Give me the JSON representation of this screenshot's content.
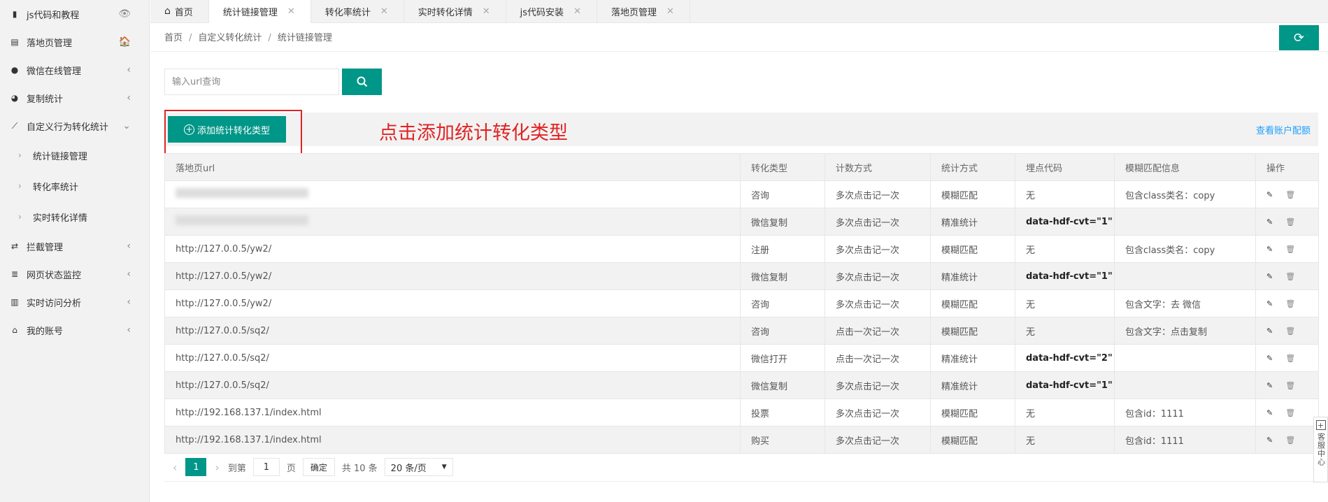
{
  "sidebar": {
    "items": [
      {
        "label": "js代码和教程",
        "icon": "bookmark-icon",
        "right": "👁"
      },
      {
        "label": "落地页管理",
        "icon": "document-icon",
        "right": "🏠"
      },
      {
        "label": "微信在线管理",
        "icon": "wechat-icon",
        "right": "‹"
      },
      {
        "label": "复制统计",
        "icon": "pie-chart-icon",
        "right": "‹"
      },
      {
        "label": "自定义行为转化统计",
        "icon": "line-chart-icon",
        "right": "⌄"
      },
      {
        "label": "统计链接管理",
        "child": true
      },
      {
        "label": "转化率统计",
        "child": true
      },
      {
        "label": "实时转化详情",
        "child": true
      },
      {
        "label": "拦截管理",
        "icon": "exchange-icon",
        "right": "‹"
      },
      {
        "label": "网页状态监控",
        "icon": "server-icon",
        "right": "‹"
      },
      {
        "label": "实时访问分析",
        "icon": "bar-chart-icon",
        "right": "‹"
      },
      {
        "label": "我的账号",
        "icon": "lock-icon",
        "right": "‹"
      }
    ]
  },
  "tabs": [
    {
      "label": "首页",
      "home": true
    },
    {
      "label": "统计链接管理",
      "active": true
    },
    {
      "label": "转化率统计"
    },
    {
      "label": "实时转化详情"
    },
    {
      "label": "js代码安装"
    },
    {
      "label": "落地页管理"
    }
  ],
  "breadcrumb": [
    "首页",
    "自定义转化统计",
    "统计链接管理"
  ],
  "search": {
    "placeholder": "输入url查询",
    "value": ""
  },
  "toolbar": {
    "add_label": "添加统计转化类型",
    "annotation": "点击添加统计转化类型",
    "quota_link": "查看账户配额"
  },
  "table": {
    "columns": [
      "落地页url",
      "转化类型",
      "计数方式",
      "统计方式",
      "埋点代码",
      "模糊匹配信息",
      "操作"
    ],
    "rows": [
      {
        "url": "",
        "url_blurred": true,
        "type": "咨询",
        "count": "多次点击记一次",
        "stat": "模糊匹配",
        "code": "无",
        "match": "包含class类名：copy"
      },
      {
        "url": "",
        "url_blurred": true,
        "type": "微信复制",
        "count": "多次点击记一次",
        "stat": "精准统计",
        "code": "data-hdf-cvt=\"1\"",
        "match": ""
      },
      {
        "url": "http://127.0.0.5/yw2/",
        "type": "注册",
        "count": "多次点击记一次",
        "stat": "模糊匹配",
        "code": "无",
        "match": "包含class类名：copy"
      },
      {
        "url": "http://127.0.0.5/yw2/",
        "type": "微信复制",
        "count": "多次点击记一次",
        "stat": "精准统计",
        "code": "data-hdf-cvt=\"1\"",
        "match": ""
      },
      {
        "url": "http://127.0.0.5/yw2/",
        "type": "咨询",
        "count": "多次点击记一次",
        "stat": "模糊匹配",
        "code": "无",
        "match": "包含文字：去 微信"
      },
      {
        "url": "http://127.0.0.5/sq2/",
        "type": "咨询",
        "count": "点击一次记一次",
        "stat": "模糊匹配",
        "code": "无",
        "match": "包含文字：点击复制"
      },
      {
        "url": "http://127.0.0.5/sq2/",
        "type": "微信打开",
        "count": "点击一次记一次",
        "stat": "精准统计",
        "code": "data-hdf-cvt=\"2\"",
        "match": ""
      },
      {
        "url": "http://127.0.0.5/sq2/",
        "type": "微信复制",
        "count": "多次点击记一次",
        "stat": "精准统计",
        "code": "data-hdf-cvt=\"1\"",
        "match": ""
      },
      {
        "url": "http://192.168.137.1/index.html",
        "type": "投票",
        "count": "多次点击记一次",
        "stat": "模糊匹配",
        "code": "无",
        "match": "包含id：1111"
      },
      {
        "url": "http://192.168.137.1/index.html",
        "type": "购买",
        "count": "多次点击记一次",
        "stat": "模糊匹配",
        "code": "无",
        "match": "包含id：1111"
      }
    ]
  },
  "pager": {
    "current": "1",
    "goto_label": "到第",
    "goto_value": "1",
    "page_unit": "页",
    "confirm": "确定",
    "total": "共 10 条",
    "page_size": "20 条/页"
  },
  "service": {
    "label": "客服中心"
  },
  "colors": {
    "accent": "#009688",
    "annotation": "#e02424",
    "link": "#1e9fff"
  }
}
